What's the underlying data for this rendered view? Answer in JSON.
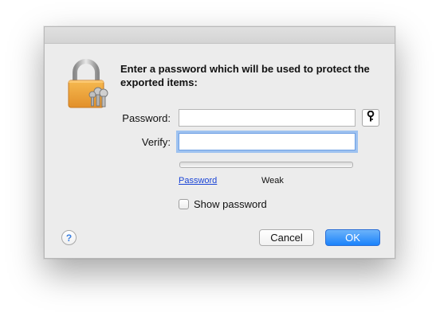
{
  "dialog": {
    "heading": "Enter a password which will be used to protect the exported items:",
    "password_label": "Password:",
    "password_value": "",
    "verify_label": "Verify:",
    "verify_value": "",
    "key_button_icon": "key-icon",
    "lock_icon": "lock-with-keys-icon",
    "strength_link": "Password",
    "strength_value": "Weak",
    "strength_level": 0,
    "show_password_label": "Show password",
    "show_password_checked": false,
    "help_label": "?",
    "cancel_label": "Cancel",
    "ok_label": "OK"
  },
  "colors": {
    "accent": "#1a82fb",
    "link": "#1a44d6",
    "focus_ring": "#9ec2f0",
    "lock_body": "#f0a43a"
  }
}
